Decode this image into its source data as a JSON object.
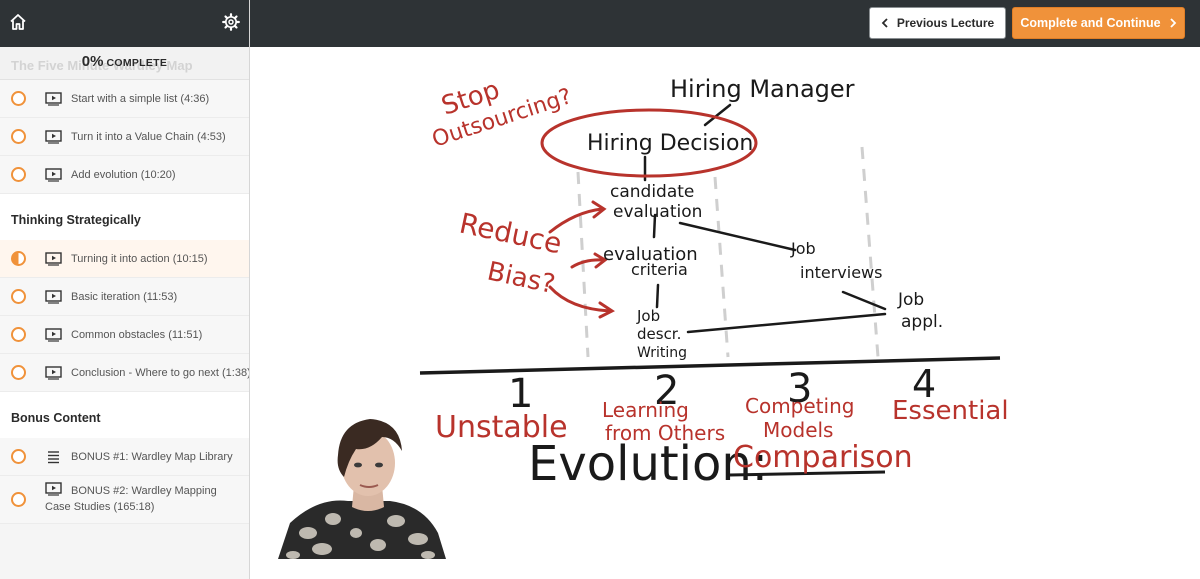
{
  "sidebar": {
    "progress_number": "0%",
    "progress_word": "COMPLETE",
    "hidden_section_title": "The Five Minute Wardley Map",
    "sections": [
      {
        "items": [
          {
            "label": "Start with a simple list (4:36)"
          },
          {
            "label": "Turn it into a Value Chain (4:53)"
          },
          {
            "label": "Add evolution (10:20)"
          }
        ]
      },
      {
        "title": "Thinking Strategically",
        "items": [
          {
            "label": "Turning it into action (10:15)"
          },
          {
            "label": "Basic iteration (11:53)"
          },
          {
            "label": "Common obstacles (11:51)"
          },
          {
            "label": "Conclusion - Where to go next (1:38)"
          }
        ]
      },
      {
        "title": "Bonus Content",
        "items": [
          {
            "label": "BONUS #1: Wardley Map Library"
          },
          {
            "label": "BONUS #2: Wardley Mapping Case Studies (165:18)"
          }
        ]
      }
    ]
  },
  "topbar": {
    "prev_label": "Previous Lecture",
    "next_label": "Complete and Continue"
  },
  "whiteboard": {
    "hiring_manager": "Hiring Manager",
    "hiring_decision": "Hiring Decision",
    "candidate": "candidate",
    "evaluation": "evaluation",
    "evaluation2": "evaluation",
    "criteria": "criteria",
    "job_interviews_1": "Job",
    "job_interviews_2": "interviews",
    "job_appl_1": "Job",
    "job_appl_2": "appl.",
    "job_desc_1": "Job",
    "job_desc_2": "descr.",
    "job_desc_3": "Writing",
    "stop_1": "Stop",
    "stop_2": "Outsourcing?",
    "reduce_1": "Reduce",
    "reduce_2": "Bias?",
    "stage1_num": "1",
    "stage2_num": "2",
    "stage3_num": "3",
    "stage4_num": "4",
    "stage1_name": "Unstable",
    "stage2_name_1": "Learning",
    "stage2_name_2": "from Others",
    "stage3_name_1": "Competing",
    "stage3_name_2": "Models",
    "stage4_name": "Essential",
    "evolution": "Evolution:",
    "comparison": "Comparison"
  },
  "colors": {
    "accent": "#f0923a",
    "topbar": "#2e3336",
    "ink_red": "#b8332c"
  }
}
